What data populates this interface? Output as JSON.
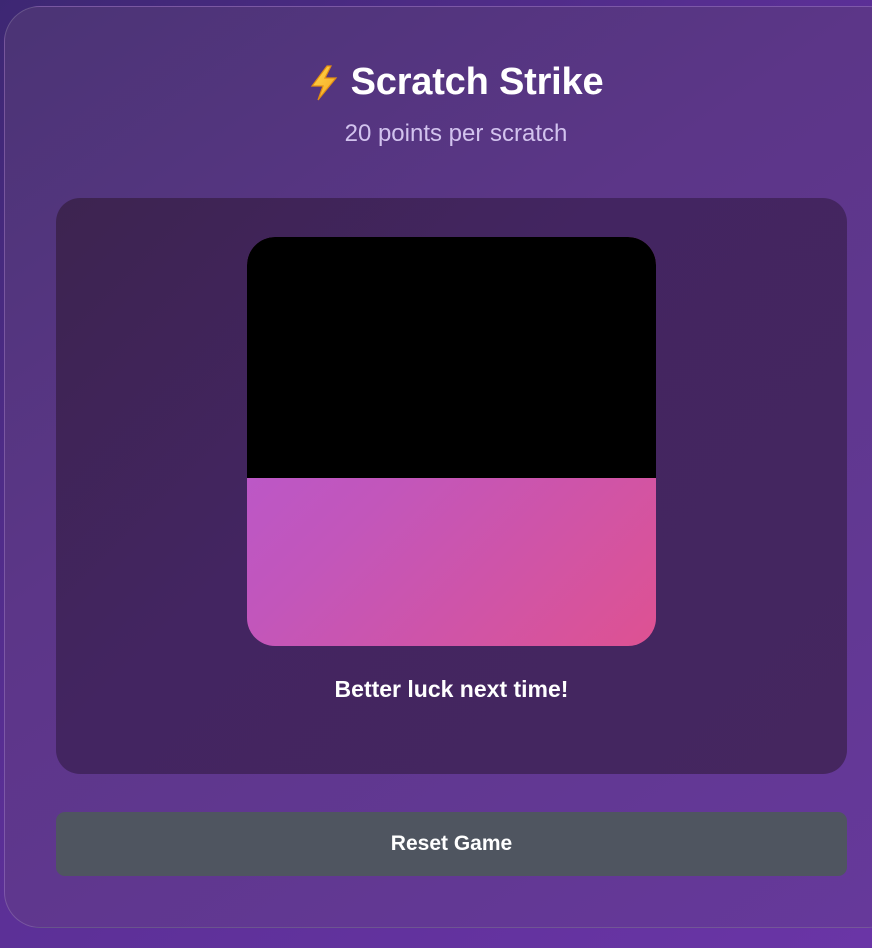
{
  "app": {
    "title": "Scratch Strike",
    "title_icon": "lightning-bolt-icon",
    "subtitle": "20 points per scratch"
  },
  "scratch_card": {
    "scratched_fraction": 0.41,
    "cover_color": "#000000",
    "prize_gradient": [
      "#b25ad8",
      "#de5292"
    ]
  },
  "result": {
    "message": "Better luck next time!"
  },
  "controls": {
    "reset_label": "Reset Game"
  },
  "colors": {
    "card_background": "#5c3688",
    "panel_background": "#432561",
    "button_background": "#4f5560"
  }
}
